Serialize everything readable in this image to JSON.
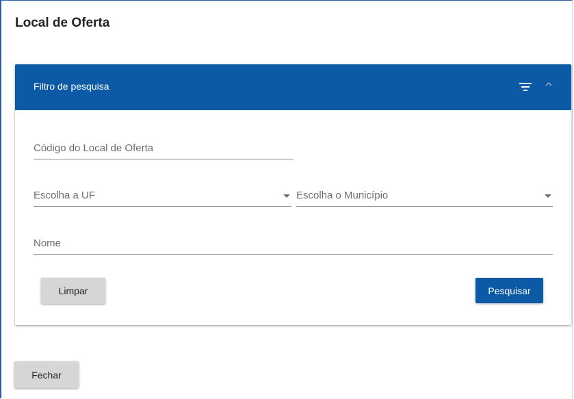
{
  "dialog": {
    "title": "Local de Oferta",
    "close_label": "Fechar"
  },
  "filter": {
    "title": "Filtro de pesquisa",
    "icons": [
      "filter-icon",
      "chevron-up-icon"
    ],
    "codigo_placeholder": "Código do Local de Oferta",
    "uf_placeholder": "Escolha a UF",
    "municipio_placeholder": "Escolha o Município",
    "nome_placeholder": "Nome",
    "clear_label": "Limpar",
    "search_label": "Pesquisar"
  },
  "colors": {
    "accent": "#0c5aa6",
    "button_grey": "#d6d6d6"
  }
}
